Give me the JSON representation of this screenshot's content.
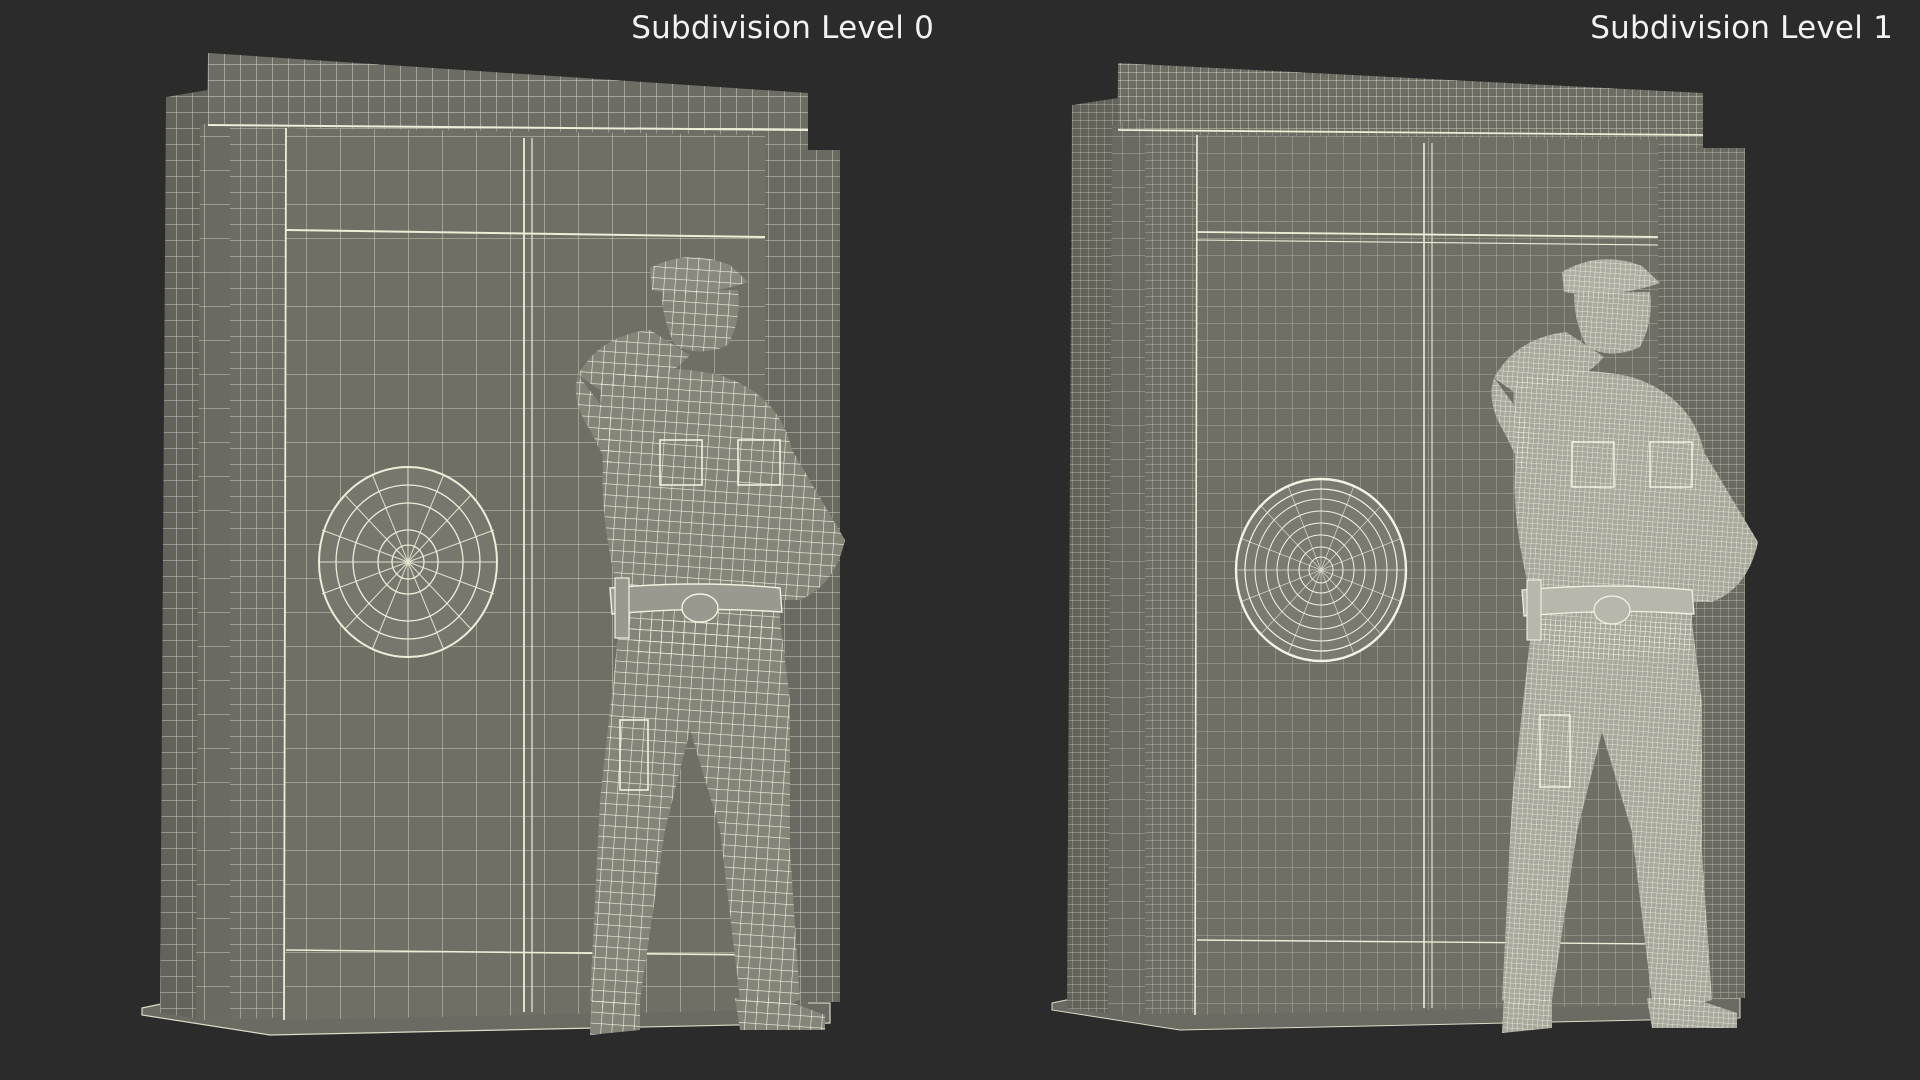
{
  "panels": [
    {
      "label": "Subdivision Level 0",
      "subdivision_level": 0
    },
    {
      "label": "Subdivision Level 1",
      "subdivision_level": 1
    }
  ],
  "colors": {
    "background": "#2b2b2b",
    "mesh_surface": "#6f6f66",
    "wire": "#e4e2cf",
    "label_text": "#f2f2f2"
  }
}
